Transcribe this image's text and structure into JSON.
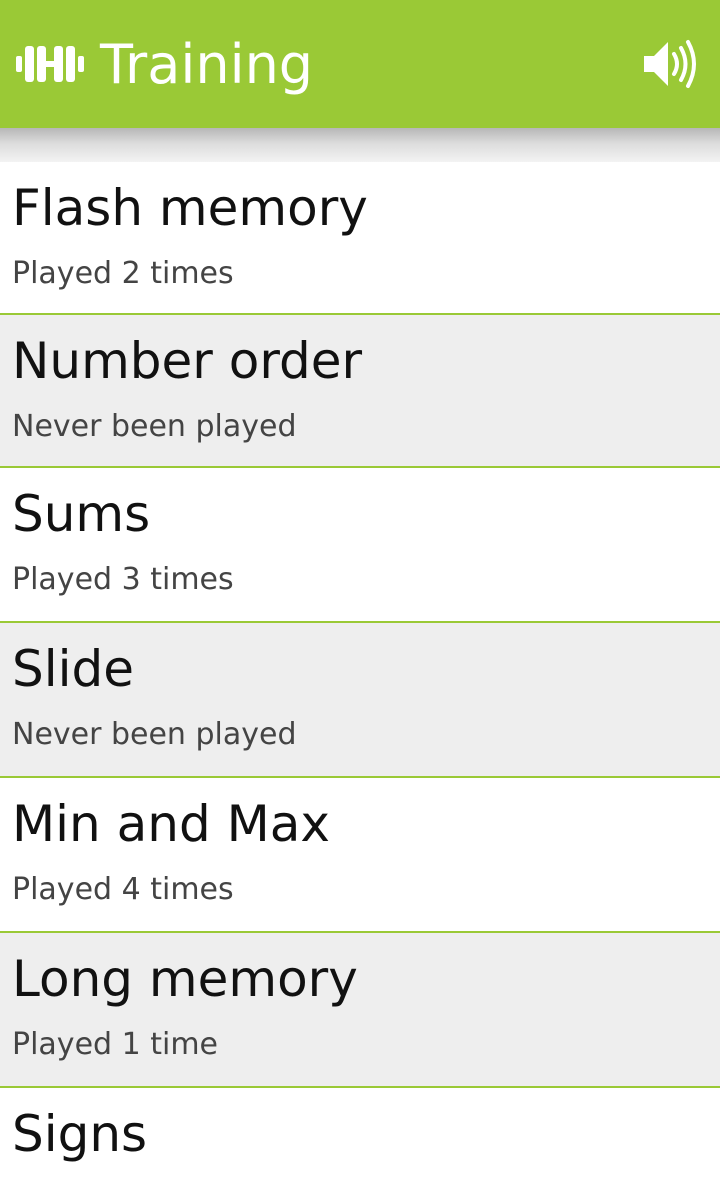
{
  "header": {
    "title": "Training",
    "app_icon": "dumbbell-icon",
    "sound_icon": "speaker-volume-icon",
    "background_color": "#9ac936"
  },
  "games": [
    {
      "title": "Flash memory",
      "subtitle": "Played 2 times"
    },
    {
      "title": "Number order",
      "subtitle": "Never been played"
    },
    {
      "title": "Sums",
      "subtitle": "Played 3 times"
    },
    {
      "title": "Slide",
      "subtitle": "Never been played"
    },
    {
      "title": "Min and Max",
      "subtitle": "Played 4 times"
    },
    {
      "title": "Long memory",
      "subtitle": "Played 1 time"
    },
    {
      "title": "Signs",
      "subtitle": ""
    }
  ]
}
